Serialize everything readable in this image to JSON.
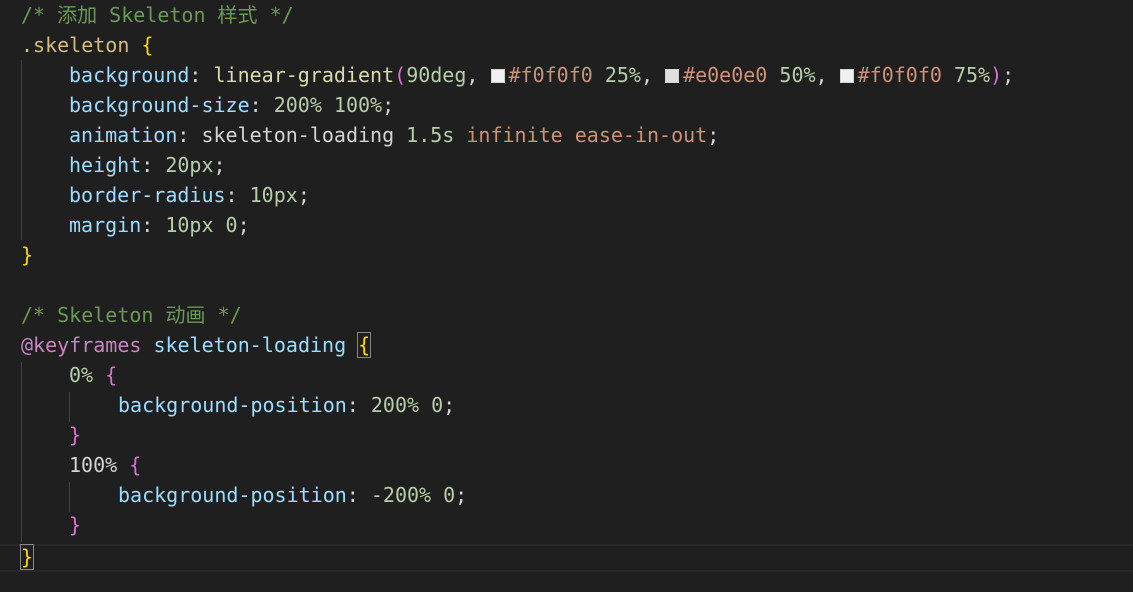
{
  "code": {
    "comment_style": "/* 添加 Skeleton 样式 */",
    "selector": ".skeleton",
    "open_brace": "{",
    "close_brace": "}",
    "bg_prop": "background",
    "bg_fn": "linear-gradient",
    "bg_deg": "90deg",
    "stop1_color": "#f0f0f0",
    "stop1_pct": "25%",
    "stop2_color": "#e0e0e0",
    "stop2_pct": "50%",
    "stop3_color": "#f0f0f0",
    "stop3_pct": "75%",
    "bgsize_prop": "background-size",
    "bgsize_val": "200% 100%",
    "anim_prop": "animation",
    "anim_name": "skeleton-loading",
    "anim_dur": "1.5s",
    "anim_iter": "infinite",
    "anim_ease": "ease-in-out",
    "height_prop": "height",
    "height_val": "20px",
    "radius_prop": "border-radius",
    "radius_val": "10px",
    "margin_prop": "margin",
    "margin_val": "10px 0",
    "comment_anim": "/* Skeleton 动画 */",
    "keyframes_kw": "@keyframes",
    "keyframes_name": "skeleton-loading",
    "kf0_sel": "0%",
    "kf0_prop": "background-position",
    "kf0_val": "200% 0",
    "kf100_sel": "100%",
    "kf100_prop": "background-position",
    "kf100_val": "-200% 0"
  },
  "colors": {
    "background": "#1f1f1f",
    "swatch_f0": "#f0f0f0",
    "swatch_e0": "#e0e0e0"
  }
}
